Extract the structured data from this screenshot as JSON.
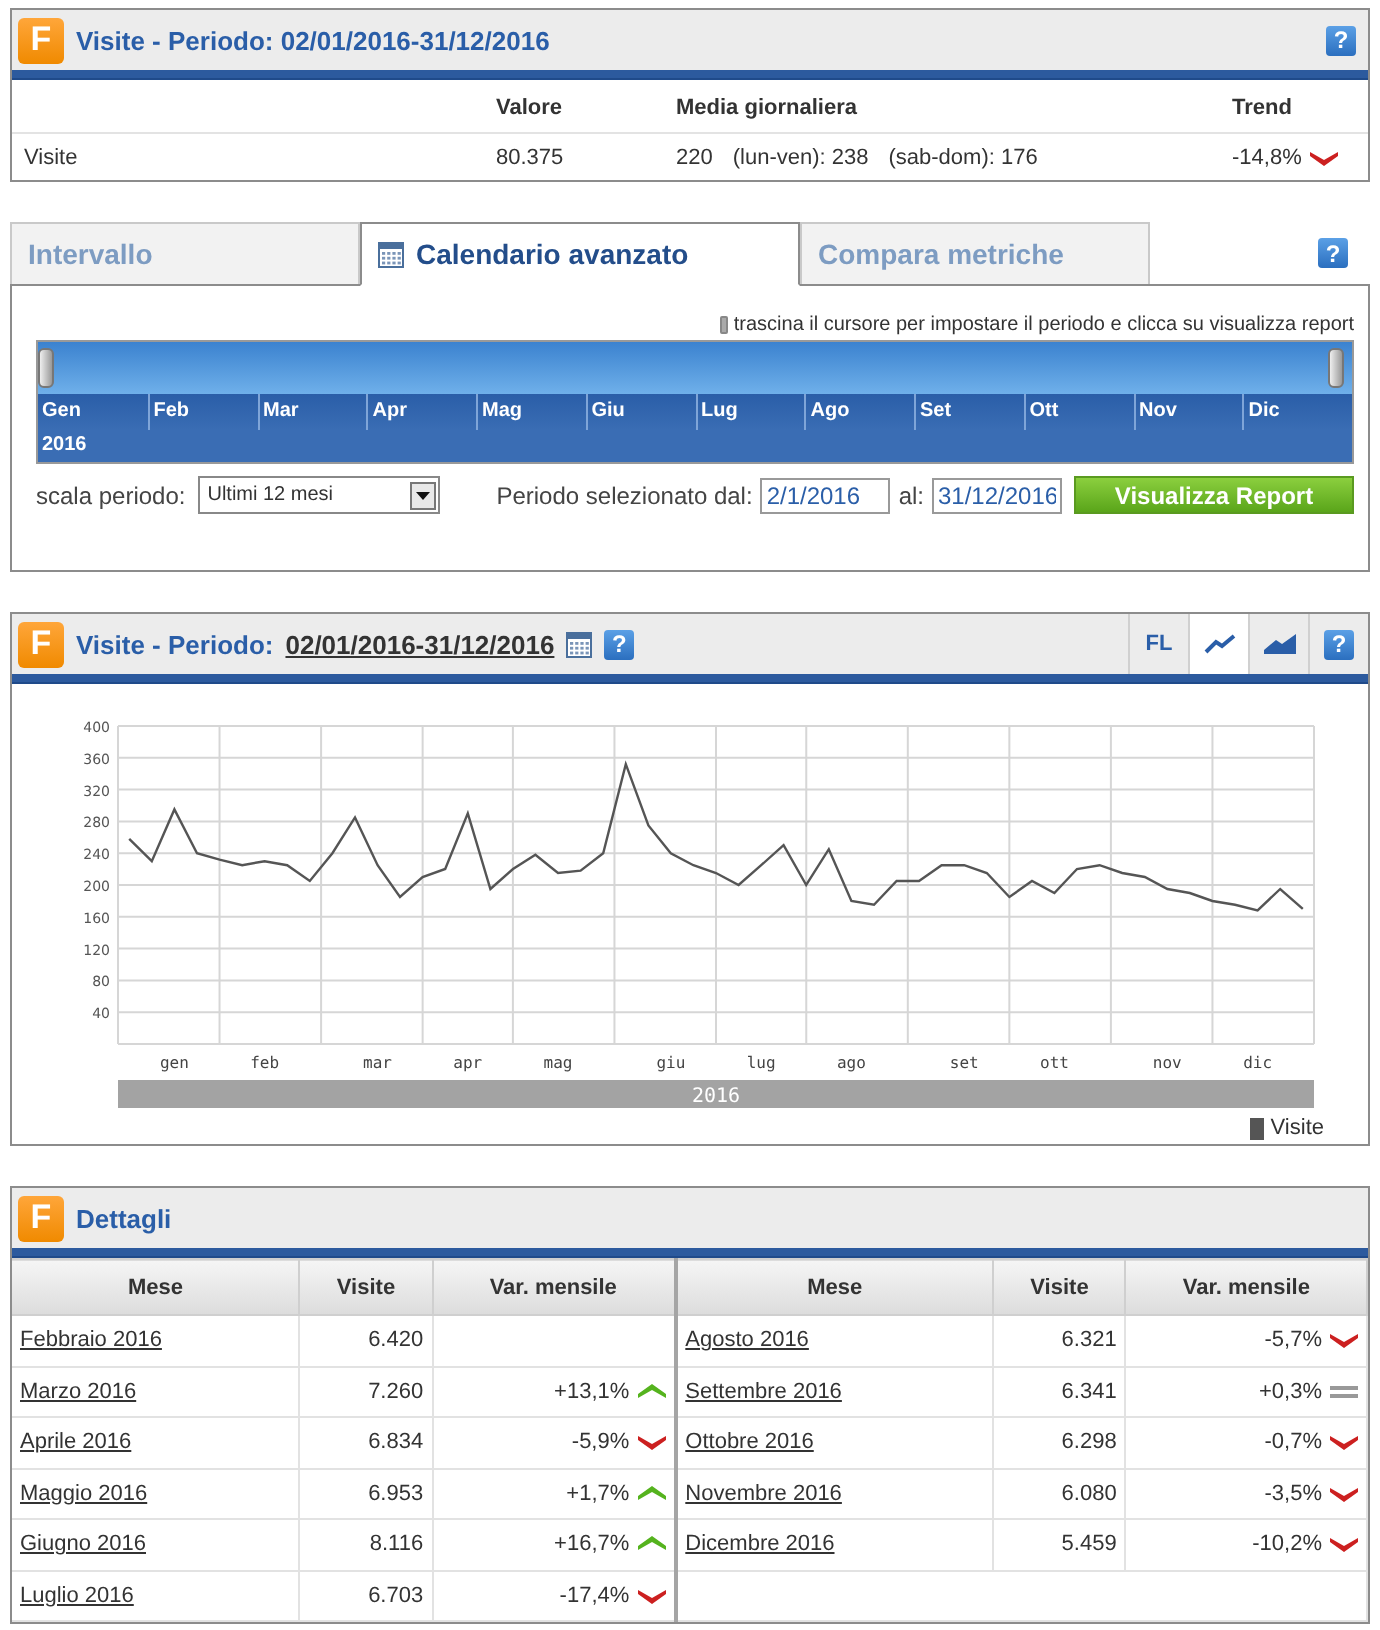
{
  "summary": {
    "logo": "F",
    "title": "Visite - Periodo: 02/01/2016-31/12/2016",
    "help": "?",
    "columns": [
      "Valore",
      "Media giornaliera",
      "Trend"
    ],
    "rows": [
      {
        "label": "Visite",
        "value": "80.375",
        "daily": "220",
        "weekdays": "(lun-ven): 238",
        "weekend": "(sab-dom): 176",
        "change": "-14,8%",
        "kind": "down"
      }
    ]
  },
  "period": {
    "help": "?",
    "tabs": [
      {
        "kind": "plain",
        "label": "Intervallo",
        "selected": false
      },
      {
        "kind": "calendar",
        "label": "Calendario avanzato",
        "selected": true
      },
      {
        "kind": "plain",
        "label": "Compara metriche",
        "selected": false
      }
    ],
    "hint": "trascina il cursore per impostare il periodo e clicca su visualizza report",
    "handles": [
      {
        "level": 0
      },
      {
        "level": 1
      }
    ],
    "months": [
      "Gen",
      "Feb",
      "Mar",
      "Apr",
      "Mag",
      "Giu",
      "Lug",
      "Ago",
      "Set",
      "Ott",
      "Nov",
      "Dic"
    ],
    "year": "2016",
    "scale_label": "scala periodo:",
    "scale_value": "Ultimi 12 mesi",
    "from_label": "Periodo selezionato dal:",
    "from_value": "2/1/2016",
    "to_label": "al:",
    "to_value": "31/12/2016",
    "button": "Visualizza Report"
  },
  "chart_panel": {
    "logo": "F",
    "title": "Visite - Periodo:",
    "period_link": "02/01/2016-31/12/2016",
    "help": "?",
    "toolbar": [
      {
        "kind": "text",
        "label": "FL",
        "selected": false
      },
      {
        "kind": "line",
        "selected": true
      },
      {
        "kind": "area",
        "selected": false
      },
      {
        "kind": "help",
        "label": "?",
        "selected": false
      }
    ],
    "year_band": "2016",
    "chart_data": {
      "type": "line",
      "grid": true,
      "ylim": [
        0,
        400
      ],
      "yticks": [
        40,
        80,
        120,
        160,
        200,
        240,
        280,
        320,
        360,
        400
      ],
      "categories": [
        null,
        null,
        "gen",
        null,
        null,
        null,
        "feb",
        null,
        null,
        null,
        null,
        "mar",
        null,
        null,
        null,
        "apr",
        null,
        null,
        null,
        "mag",
        null,
        null,
        null,
        null,
        "giu",
        null,
        null,
        null,
        "lug",
        null,
        null,
        null,
        "ago",
        null,
        null,
        null,
        null,
        "set",
        null,
        null,
        null,
        "ott",
        null,
        null,
        null,
        null,
        "nov",
        null,
        null,
        null,
        "dic",
        null,
        null
      ],
      "series": [
        {
          "name": "Visite",
          "color": "#555555",
          "values": [
            258,
            230,
            295,
            240,
            232,
            225,
            230,
            225,
            205,
            240,
            285,
            225,
            185,
            210,
            220,
            290,
            195,
            220,
            238,
            215,
            218,
            240,
            352,
            275,
            240,
            225,
            215,
            200,
            225,
            250,
            200,
            245,
            180,
            175,
            205,
            205,
            225,
            225,
            215,
            185,
            205,
            190,
            220,
            225,
            215,
            210,
            195,
            190,
            180,
            175,
            168,
            195,
            170
          ]
        }
      ]
    }
  },
  "details": {
    "logo": "F",
    "title": "Dettagli",
    "columns": [
      "Mese",
      "Visite",
      "Var. mensile",
      "Mese",
      "Visite",
      "Var. mensile"
    ],
    "left_rows": [
      {
        "month": "Febbraio 2016",
        "visits": "6.420"
      },
      {
        "kind": "up",
        "month": "Marzo 2016",
        "visits": "7.260",
        "change": "+13,1%"
      },
      {
        "kind": "down",
        "month": "Aprile 2016",
        "visits": "6.834",
        "change": "-5,9%"
      },
      {
        "kind": "up",
        "month": "Maggio 2016",
        "visits": "6.953",
        "change": "+1,7%"
      },
      {
        "kind": "up",
        "month": "Giugno 2016",
        "visits": "8.116",
        "change": "+16,7%"
      },
      {
        "kind": "down",
        "month": "Luglio 2016",
        "visits": "6.703",
        "change": "-17,4%"
      }
    ],
    "right_rows": [
      {
        "kind": "down",
        "month": "Agosto 2016",
        "visits": "6.321",
        "change": "-5,7%"
      },
      {
        "kind": "flat",
        "month": "Settembre 2016",
        "visits": "6.341",
        "change": "+0,3%"
      },
      {
        "kind": "down",
        "month": "Ottobre 2016",
        "visits": "6.298",
        "change": "-0,7%"
      },
      {
        "kind": "down",
        "month": "Novembre 2016",
        "visits": "6.080",
        "change": "-3,5%"
      },
      {
        "kind": "down",
        "month": "Dicembre 2016",
        "visits": "5.459",
        "change": "-10,2%"
      }
    ]
  }
}
